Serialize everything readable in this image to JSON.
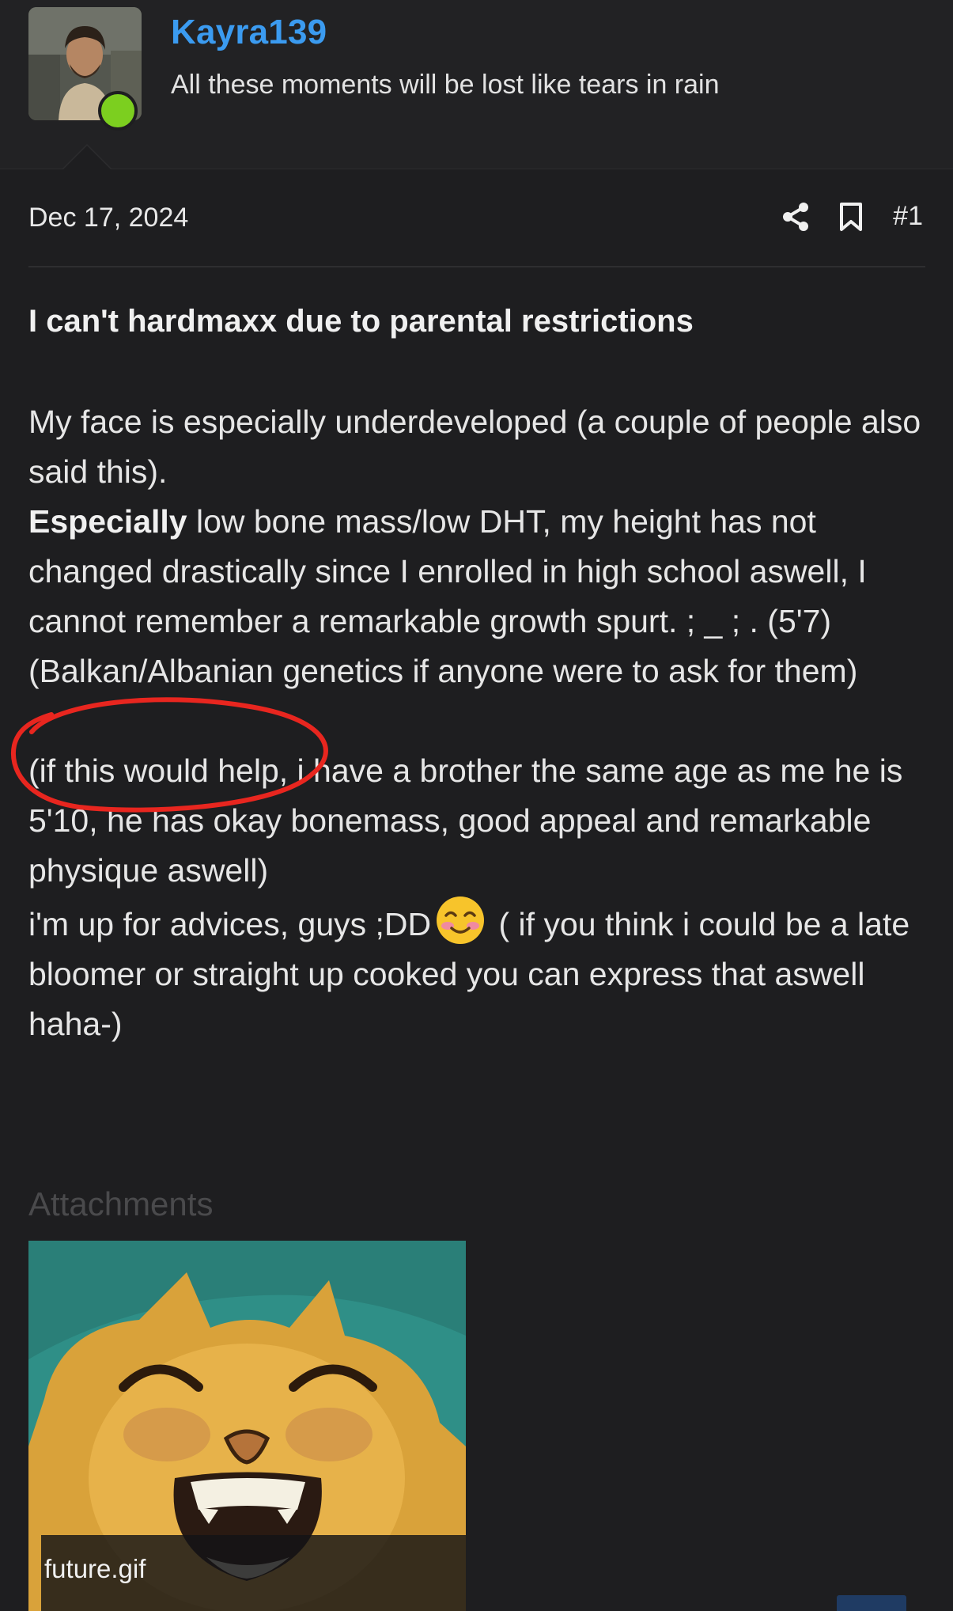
{
  "user": {
    "username": "Kayra139",
    "title": "All these moments will be lost like tears in rain",
    "status": "online"
  },
  "post": {
    "date": "Dec 17, 2024",
    "number": "#1",
    "heading": "I can't hardmaxx due to parental restrictions",
    "paragraph1_line1": "My face is especially underdeveloped (a couple of people also said this).",
    "paragraph1_bold": "Especially",
    "paragraph1_rest": " low bone mass/low DHT, my height has not changed drastically since I enrolled in high school aswell, I cannot remember a remarkable growth spurt. ; _ ; . (5'7)",
    "paragraph1_genetics": "(Balkan/Albanian genetics if anyone were to ask for them)",
    "paragraph2": "(if this would help, i have a brother the same age as me he is 5'10, he has okay bonemass, good appeal and remarkable physique aswell)",
    "paragraph3_before_emoji": "i'm up for advices, guys ;DD",
    "paragraph3_after_emoji": " ( if you think i could be a late bloomer or straight up cooked you can express that aswell haha-)"
  },
  "icons": {
    "share": "share-icon",
    "bookmark": "bookmark-icon",
    "emoji": "smiling-face-emoji"
  },
  "attachments": {
    "label": "Attachments",
    "items": [
      {
        "filename": "future.gif"
      }
    ]
  },
  "colors": {
    "background": "#1e1e20",
    "username": "#3b9bf0",
    "online": "#7ccf1f",
    "annotation": "#e8261f"
  }
}
